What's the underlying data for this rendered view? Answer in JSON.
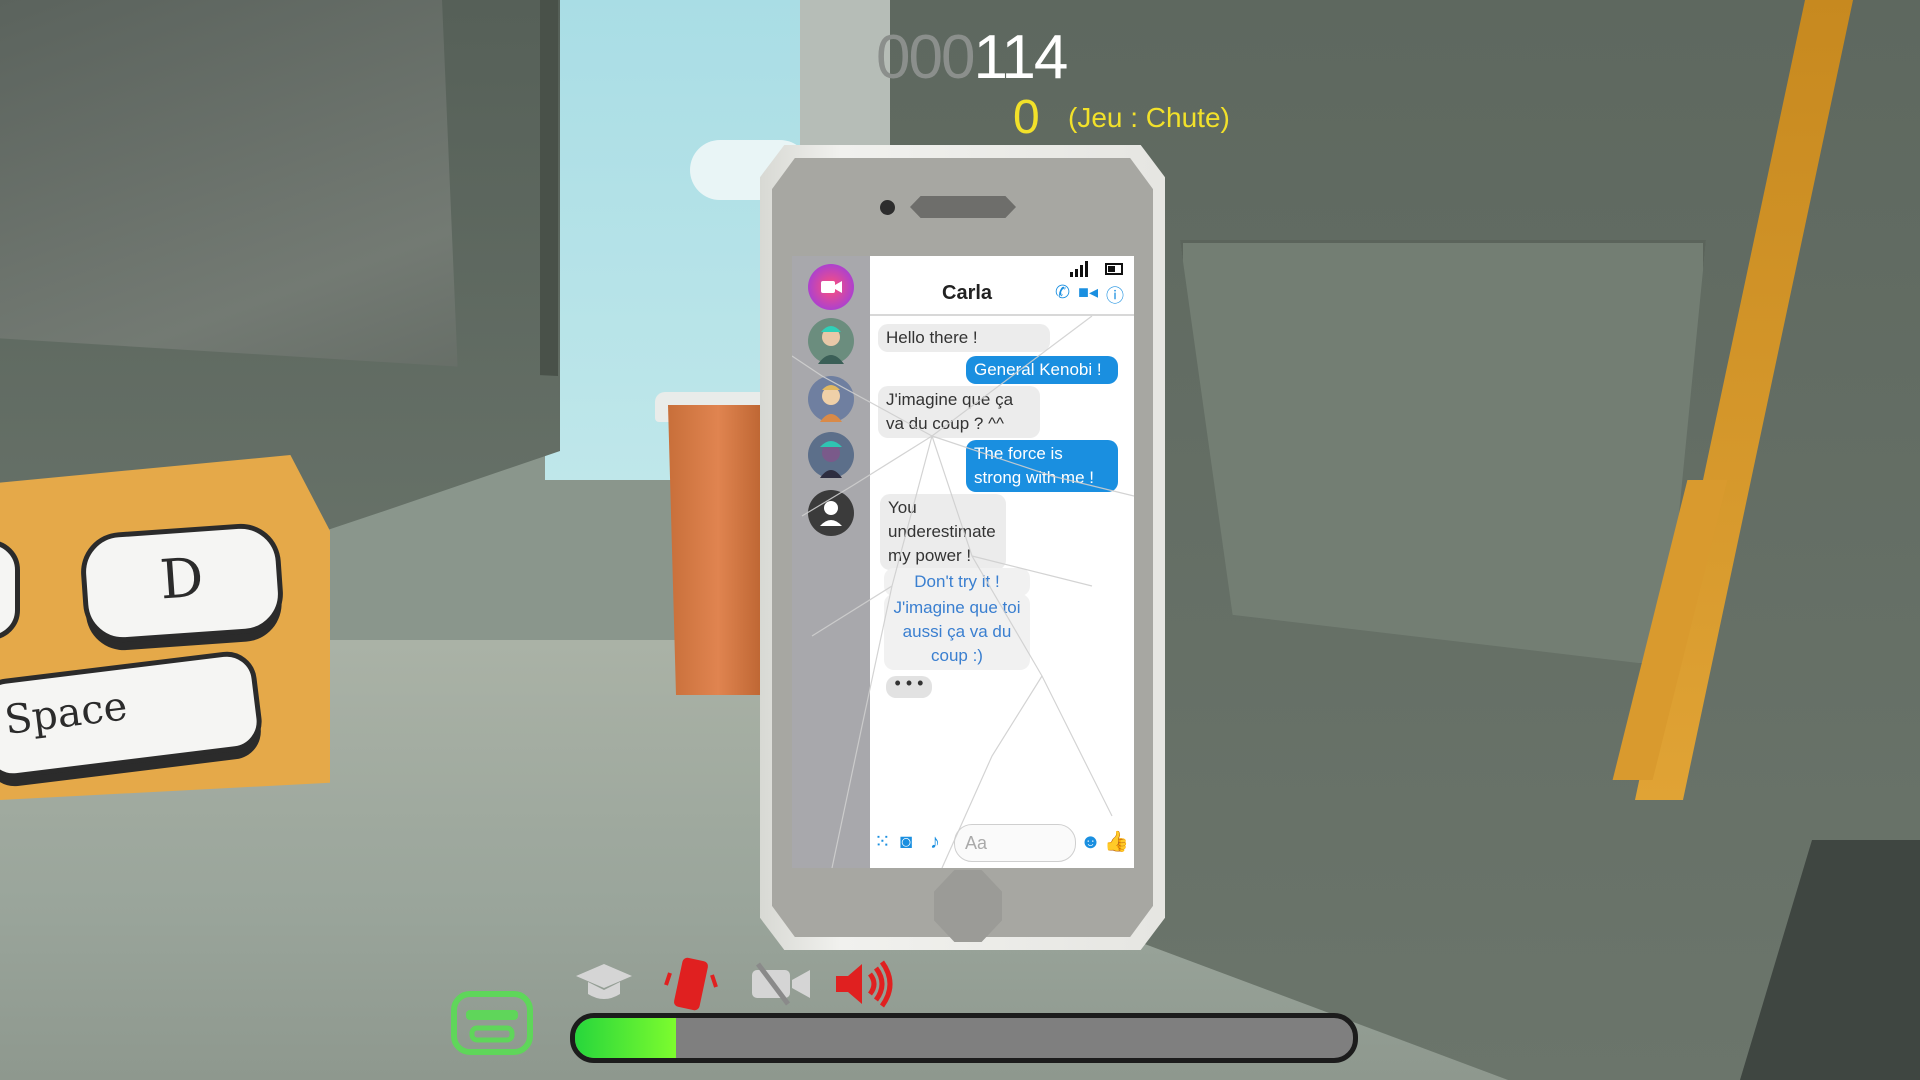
{
  "hud": {
    "score_dim": "000",
    "score_lit": "114",
    "combo": "0",
    "mode": "(Jeu : Chute)",
    "progress": 0.13
  },
  "hint": {
    "key_d": "D",
    "key_space": "Space"
  },
  "phone": {
    "contact": "Carla",
    "messages": [
      {
        "side": "in",
        "text": "Hello there !"
      },
      {
        "side": "out",
        "text": "General Kenobi !"
      },
      {
        "side": "in",
        "text": "J'imagine que ça va du coup ? ^^"
      },
      {
        "side": "out",
        "text": "The force is strong with me !"
      },
      {
        "side": "in",
        "text": "You underestimate my power !"
      }
    ],
    "options": [
      "Don't try it !",
      "J'imagine que toi aussi ça va du coup :)"
    ],
    "typing": "• • •",
    "input_placeholder": "Aa"
  },
  "colors": {
    "score_yellow": "#f2e12a",
    "messenger_blue": "#1a8fe0",
    "alert_red": "#e02020",
    "bar_green": "#27d63c"
  },
  "icons": [
    "robot-face-icon",
    "graduation-cap-icon",
    "phone-shake-icon",
    "camera-muted-icon",
    "speaker-icon"
  ]
}
